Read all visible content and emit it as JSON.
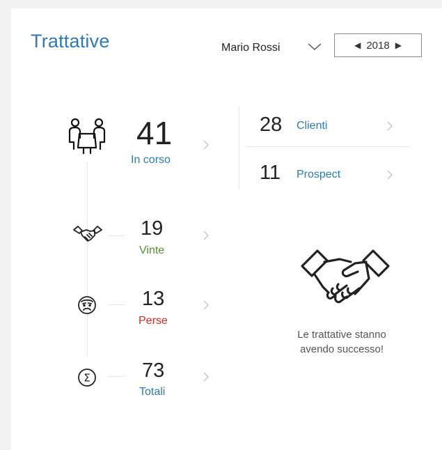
{
  "header": {
    "title": "Trattative",
    "user_name": "Mario Rossi",
    "year": "2018"
  },
  "stats": {
    "in_corso": {
      "value": "41",
      "label": "In corso"
    },
    "vinte": {
      "value": "19",
      "label": "Vinte"
    },
    "perse": {
      "value": "13",
      "label": "Perse"
    },
    "totali": {
      "value": "73",
      "label": "Totali"
    }
  },
  "breakdown": {
    "clienti": {
      "value": "28",
      "label": "Clienti"
    },
    "prospect": {
      "value": "11",
      "label": "Prospect"
    }
  },
  "message": {
    "line1": "Le trattative stanno",
    "line2": "avendo successo!"
  },
  "colors": {
    "accent_blue": "#2f7ab5",
    "win_green": "#5a8a3a",
    "loss_red": "#e0261c"
  }
}
